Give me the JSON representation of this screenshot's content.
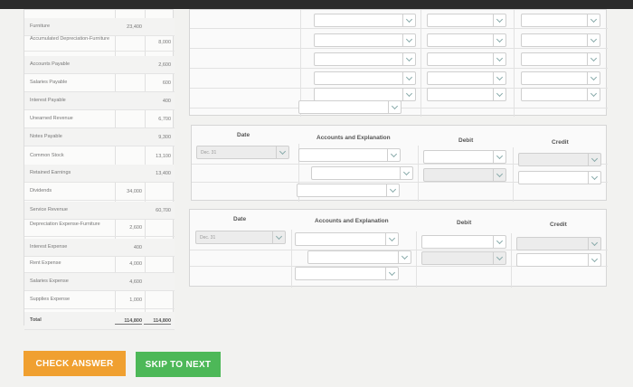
{
  "trial_balance": {
    "rows": [
      {
        "account": "Furniture",
        "debit": "23,400",
        "credit": ""
      },
      {
        "account": "Accumulated Depreciation-Furniture",
        "debit": "",
        "credit": "8,000"
      },
      {
        "account": "Accounts Payable",
        "debit": "",
        "credit": "2,600"
      },
      {
        "account": "Salaries Payable",
        "debit": "",
        "credit": "600"
      },
      {
        "account": "Interest Payable",
        "debit": "",
        "credit": "400"
      },
      {
        "account": "Unearned Revenue",
        "debit": "",
        "credit": "6,700"
      },
      {
        "account": "Notes Payable",
        "debit": "",
        "credit": "9,300"
      },
      {
        "account": "Common Stock",
        "debit": "",
        "credit": "13,100"
      },
      {
        "account": "Retained Earnings",
        "debit": "",
        "credit": "13,400"
      },
      {
        "account": "Dividends",
        "debit": "34,000",
        "credit": ""
      },
      {
        "account": "Service Revenue",
        "debit": "",
        "credit": "60,700"
      },
      {
        "account": "Depreciation Expense-Furniture",
        "debit": "2,600",
        "credit": ""
      },
      {
        "account": "Interest Expense",
        "debit": "400",
        "credit": ""
      },
      {
        "account": "Rent Expense",
        "debit": "4,000",
        "credit": ""
      },
      {
        "account": "Salaries Expense",
        "debit": "4,600",
        "credit": ""
      },
      {
        "account": "Supplies Expense",
        "debit": "1,000",
        "credit": ""
      },
      {
        "account": "Total",
        "debit": "114,800",
        "credit": "114,800"
      }
    ]
  },
  "journal": {
    "headers": {
      "date": "Date",
      "accounts": "Accounts and Explanation",
      "debit": "Debit",
      "credit": "Credit"
    },
    "entry1_date": "Dec. 31",
    "entry2_date": "Dec. 31"
  },
  "buttons": {
    "check": "CHECK ANSWER",
    "skip": "SKIP TO NEXT"
  }
}
